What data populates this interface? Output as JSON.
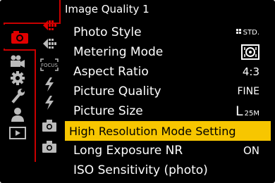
{
  "menu": {
    "title": "Image Quality 1",
    "items": [
      {
        "label": "Photo Style",
        "value": "STD.",
        "value_icon": "photo-style-std-icon"
      },
      {
        "label": "Metering Mode",
        "value": "",
        "value_icon": "multiple-metering-icon"
      },
      {
        "label": "Aspect Ratio",
        "value": "4:3"
      },
      {
        "label": "Picture Quality",
        "value": "FINE"
      },
      {
        "label": "Picture Size",
        "value_big": "L",
        "value_small": "25M"
      },
      {
        "label": "High Resolution Mode Setting",
        "value": "",
        "selected": true
      },
      {
        "label": "Long Exposure NR",
        "value": "ON"
      },
      {
        "label": "ISO Sensitivity (photo)",
        "value": ""
      }
    ]
  },
  "main_tabs": [
    {
      "icon": "camera-photo-icon",
      "active": true
    },
    {
      "icon": "video-camera-icon"
    },
    {
      "icon": "gear-icon"
    },
    {
      "icon": "wrench-icon"
    },
    {
      "icon": "user-icon"
    },
    {
      "icon": "playback-icon"
    }
  ],
  "sub_tabs": [
    {
      "icon": "image-quality-1-icon",
      "active": true
    },
    {
      "icon": "image-quality-2-icon"
    },
    {
      "icon": "focus-icon",
      "text": "FOCUS"
    },
    {
      "icon": "flash-1-icon"
    },
    {
      "icon": "flash-2-icon"
    },
    {
      "icon": "camera-1-icon"
    },
    {
      "icon": "camera-2-icon"
    }
  ],
  "colors": {
    "accent_red": "#c80000",
    "highlight": "#f7c600",
    "background": "#000000",
    "icon_inactive": "#bbbbbb"
  }
}
